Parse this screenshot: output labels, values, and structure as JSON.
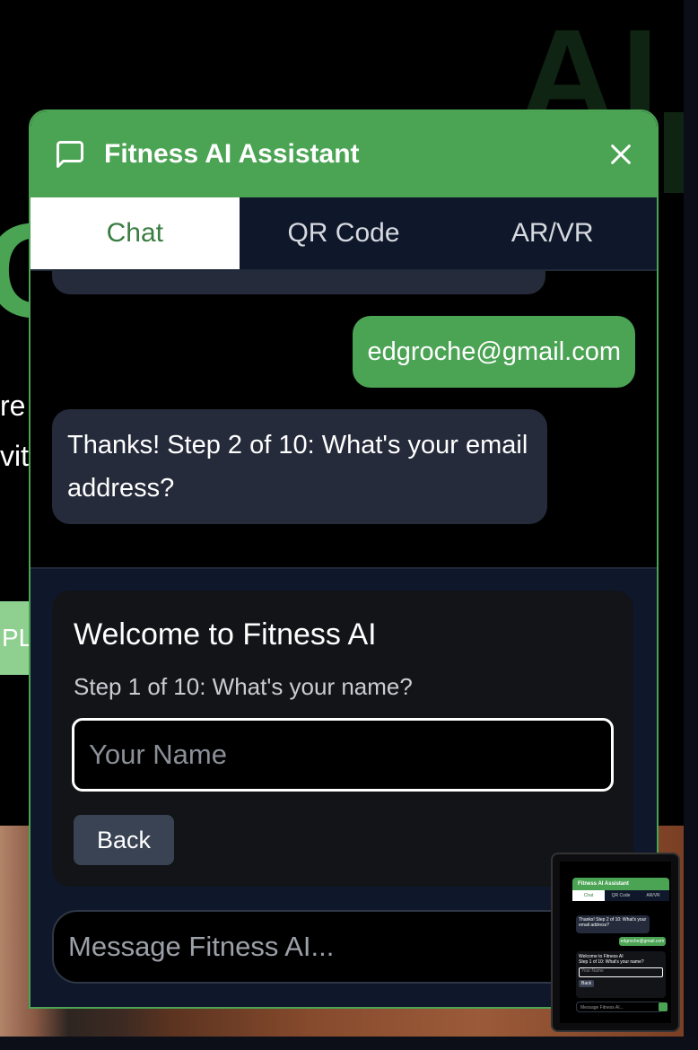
{
  "widget": {
    "title": "Fitness AI Assistant",
    "tabs": [
      {
        "label": "Chat",
        "active": true
      },
      {
        "label": "QR Code",
        "active": false
      },
      {
        "label": "AR/VR",
        "active": false
      }
    ]
  },
  "messages": [
    {
      "role": "user",
      "text": "edgroche@gmail.com"
    },
    {
      "role": "bot",
      "text": "Thanks! Step 2 of 10: What's your email address?"
    }
  ],
  "onboarding": {
    "title": "Welcome to Fitness AI",
    "step": "Step 1 of 10: What's your name?",
    "name_placeholder": "Your Name",
    "back_label": "Back"
  },
  "composer": {
    "placeholder": "Message Fitness AI..."
  },
  "background": {
    "heading_fragment": "AI",
    "letter_fragment": "G",
    "text_fragment_1": "re",
    "text_fragment_2": "vitl",
    "button_fragment": "PL"
  },
  "thumbnail": {
    "title": "Fitness AI Assistant",
    "tabs": [
      "Chat",
      "QR Code",
      "AR/VR"
    ],
    "bot_text": "Thanks! Step 2 of 10: What's your email address?",
    "user_text": "edgroche@gmail.com",
    "card_title": "Welcome to Fitness AI",
    "card_step": "Step 1 of 10: What's your name?",
    "name_placeholder": "Your Name",
    "back_label": "Back",
    "composer_placeholder": "Message Fitness AI..."
  },
  "colors": {
    "brand_green": "#4ba354",
    "panel_dark": "#0f172a",
    "bubble_dark": "#252b3b"
  }
}
